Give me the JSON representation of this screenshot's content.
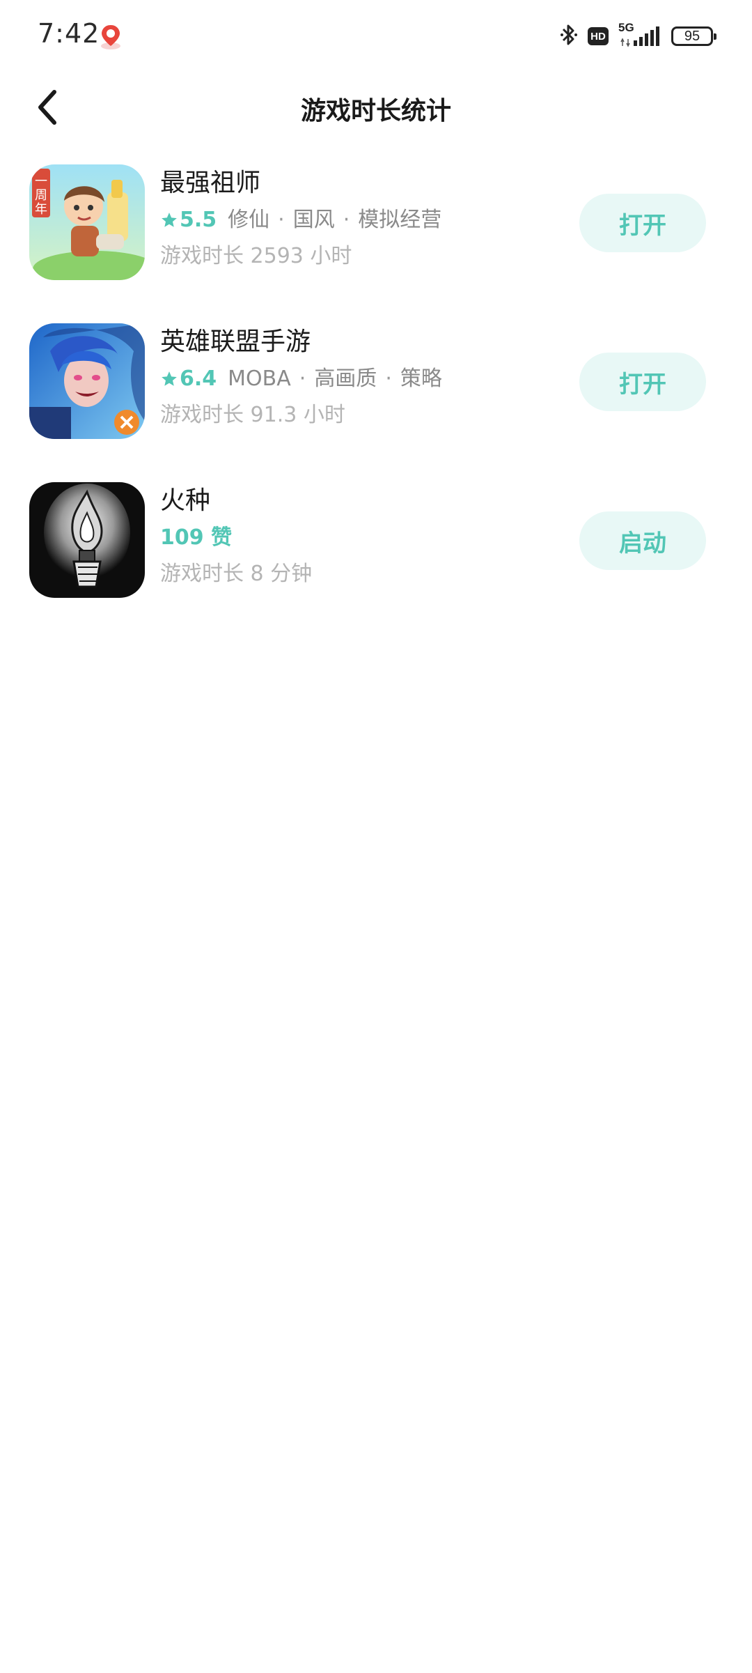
{
  "status_bar": {
    "time": "7:42",
    "network": "5G",
    "hd": "HD",
    "battery": "95"
  },
  "header": {
    "title": "游戏时长统计"
  },
  "games": [
    {
      "name": "最强祖师",
      "rating": "5.5",
      "tags": [
        "修仙",
        "国风",
        "模拟经营"
      ],
      "duration": "游戏时长 2593 小时",
      "action": "打开",
      "icon": "zuishi-game-icon"
    },
    {
      "name": "英雄联盟手游",
      "rating": "6.4",
      "tags": [
        "MOBA",
        "高画质",
        "策略"
      ],
      "duration": "游戏时长 91.3 小时",
      "action": "打开",
      "icon": "lol-mobile-game-icon"
    },
    {
      "name": "火种",
      "likes": "109 赞",
      "duration": "游戏时长 8 分钟",
      "action": "启动",
      "icon": "torch-game-icon"
    }
  ],
  "colors": {
    "accent": "#52c6b5",
    "button_bg": "#e8f8f6"
  }
}
